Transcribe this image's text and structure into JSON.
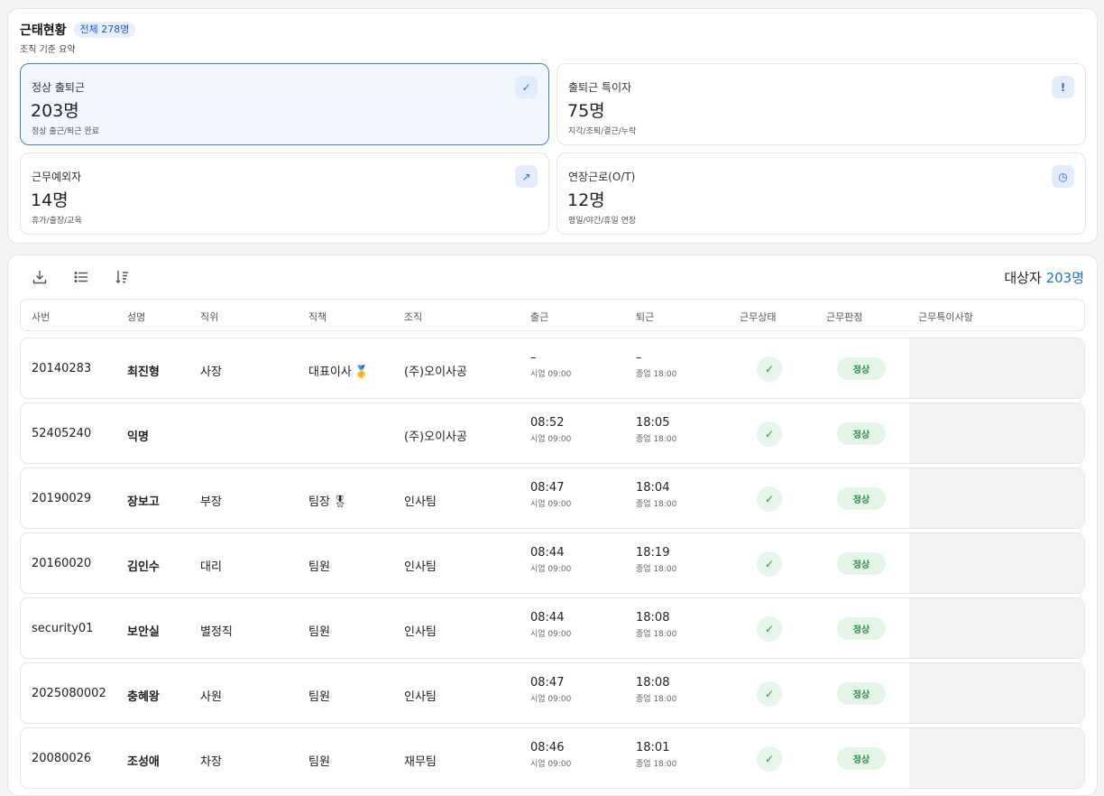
{
  "summary": {
    "title": "근태현황",
    "total_badge": "전체 278명",
    "subtitle": "조직 기준 요약",
    "cards": [
      {
        "label": "정상 출퇴근",
        "value": "203명",
        "desc": "정상 출근/퇴근 완료",
        "icon": "check-icon",
        "glyph": "✓"
      },
      {
        "label": "출퇴근 특이자",
        "value": "75명",
        "desc": "지각/조퇴/결근/누락",
        "icon": "exclamation-icon",
        "glyph": "!"
      },
      {
        "label": "근무예외자",
        "value": "14명",
        "desc": "휴가/출장/교육",
        "icon": "arrow-diagonal-icon",
        "glyph": "↗"
      },
      {
        "label": "연장근로(O/T)",
        "value": "12명",
        "desc": "평일/야간/휴일 연장",
        "icon": "clock-icon",
        "glyph": "◷"
      }
    ]
  },
  "toolbar": {
    "target_label": "대상자",
    "target_count": "203명"
  },
  "table": {
    "columns": [
      "사번",
      "성명",
      "직위",
      "직책",
      "조직",
      "출근",
      "퇴근",
      "근무상태",
      "근무판정",
      "근무특이사항"
    ],
    "rows": [
      {
        "id": "20140283",
        "name": "최진형",
        "position": "사장",
        "role": "대표이사",
        "medal": "🥇",
        "org": "(주)오이사공",
        "in": "–",
        "in_sub": "시업 09:00",
        "out": "–",
        "out_sub": "종업 18:00",
        "status": "✓",
        "judge": "정상"
      },
      {
        "id": "52405240",
        "name": "익명",
        "position": "",
        "role": "",
        "medal": "",
        "org": "(주)오이사공",
        "in": "08:52",
        "in_sub": "시업 09:00",
        "out": "18:05",
        "out_sub": "종업 18:00",
        "status": "✓",
        "judge": "정상"
      },
      {
        "id": "20190029",
        "name": "장보고",
        "position": "부장",
        "role": "팀장",
        "medal": "🎖",
        "org": "인사팀",
        "in": "08:47",
        "in_sub": "시업 09:00",
        "out": "18:04",
        "out_sub": "종업 18:00",
        "status": "✓",
        "judge": "정상"
      },
      {
        "id": "20160020",
        "name": "김인수",
        "position": "대리",
        "role": "팀원",
        "medal": "",
        "org": "인사팀",
        "in": "08:44",
        "in_sub": "시업 09:00",
        "out": "18:19",
        "out_sub": "종업 18:00",
        "status": "✓",
        "judge": "정상"
      },
      {
        "id": "security01",
        "name": "보안실",
        "position": "별정직",
        "role": "팀원",
        "medal": "",
        "org": "인사팀",
        "in": "08:44",
        "in_sub": "시업 09:00",
        "out": "18:08",
        "out_sub": "종업 18:00",
        "status": "✓",
        "judge": "정상"
      },
      {
        "id": "2025080002",
        "name": "충혜왕",
        "position": "사원",
        "role": "팀원",
        "medal": "",
        "org": "인사팀",
        "in": "08:47",
        "in_sub": "시업 09:00",
        "out": "18:08",
        "out_sub": "종업 18:00",
        "status": "✓",
        "judge": "정상"
      },
      {
        "id": "20080026",
        "name": "조성애",
        "position": "차장",
        "role": "팀원",
        "medal": "",
        "org": "재무팀",
        "in": "08:46",
        "in_sub": "시업 09:00",
        "out": "18:01",
        "out_sub": "종업 18:00",
        "status": "✓",
        "judge": "정상"
      }
    ]
  }
}
